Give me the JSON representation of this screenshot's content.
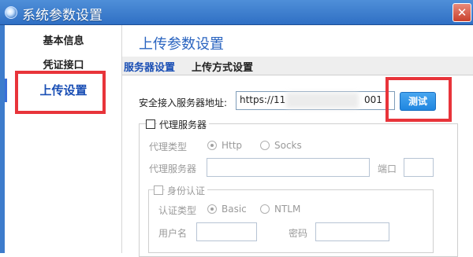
{
  "window": {
    "title": "系统参数设置",
    "close_glyph": "✕"
  },
  "sidebar": {
    "items": [
      {
        "label": "基本信息"
      },
      {
        "label": "凭证接口"
      },
      {
        "label": "上传设置"
      }
    ]
  },
  "main": {
    "heading": "上传参数设置",
    "tabs": [
      {
        "label": "服务器设置"
      },
      {
        "label": "上传方式设置"
      }
    ],
    "server": {
      "label": "安全接入服务器地址:",
      "value_prefix": "https://11",
      "value_suffix": "001",
      "test_button": "测试"
    },
    "proxy": {
      "title": "代理服务器",
      "type_label": "代理类型",
      "type_options": [
        "Http",
        "Socks"
      ],
      "server_label": "代理服务器",
      "port_label": "端口",
      "auth": {
        "title": "身份认证",
        "type_label": "认证类型",
        "type_options": [
          "Basic",
          "NTLM"
        ],
        "user_label": "用户名",
        "password_label": "密码"
      }
    }
  },
  "colors": {
    "titlebar": "#3a7bd0",
    "accent": "#1a4fb5",
    "highlight": "#e8343a",
    "test_button": "#2590e6"
  }
}
